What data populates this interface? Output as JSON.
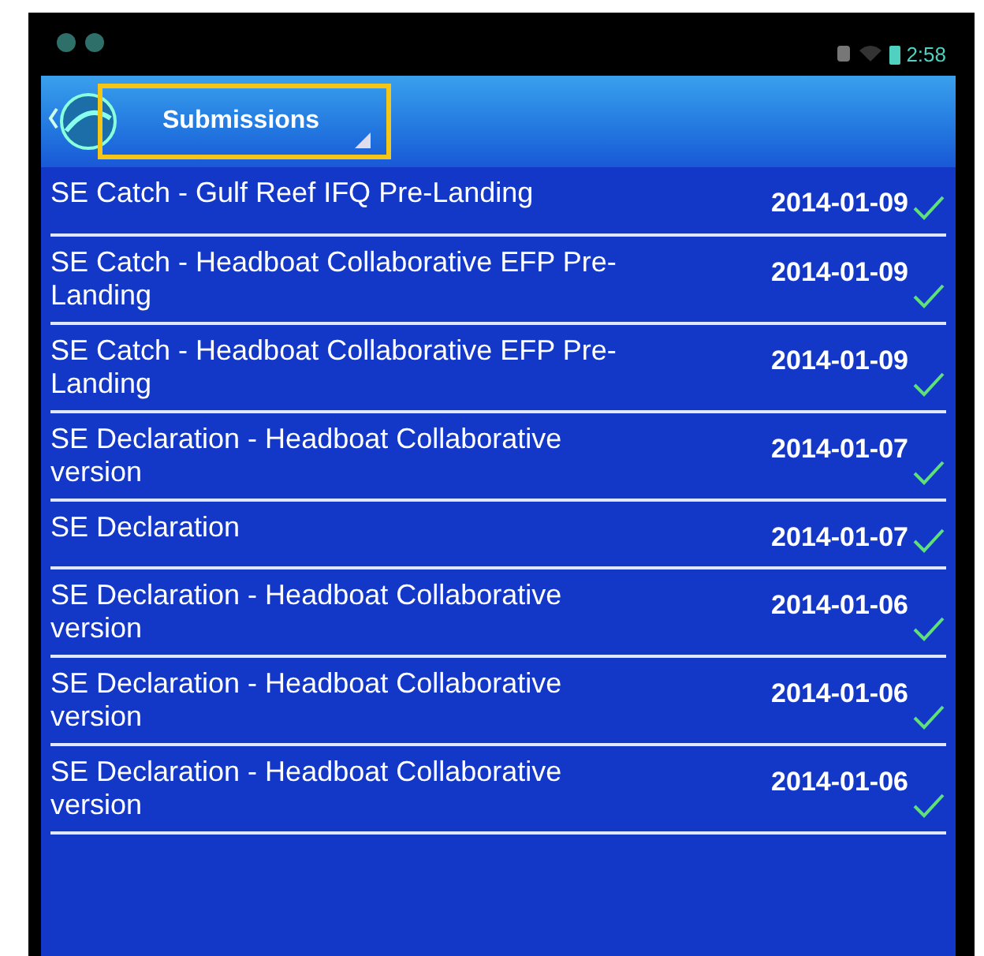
{
  "status_bar": {
    "time": "2:58"
  },
  "action_bar": {
    "title": "Submissions",
    "highlighted": true
  },
  "submissions": [
    {
      "title": "SE Catch - Gulf Reef IFQ Pre-Landing",
      "date": "2014-01-09",
      "checked": true
    },
    {
      "title": "SE Catch - Headboat Collaborative EFP Pre-Landing",
      "date": "2014-01-09",
      "checked": true
    },
    {
      "title": "SE Catch - Headboat Collaborative EFP Pre-Landing",
      "date": "2014-01-09",
      "checked": true
    },
    {
      "title": "SE Declaration - Headboat Collaborative version",
      "date": "2014-01-07",
      "checked": true
    },
    {
      "title": "SE Declaration",
      "date": "2014-01-07",
      "checked": true
    },
    {
      "title": "SE Declaration - Headboat Collaborative version",
      "date": "2014-01-06",
      "checked": true
    },
    {
      "title": "SE Declaration - Headboat Collaborative version",
      "date": "2014-01-06",
      "checked": true
    },
    {
      "title": "SE Declaration - Headboat Collaborative version",
      "date": "2014-01-06",
      "checked": true
    }
  ]
}
